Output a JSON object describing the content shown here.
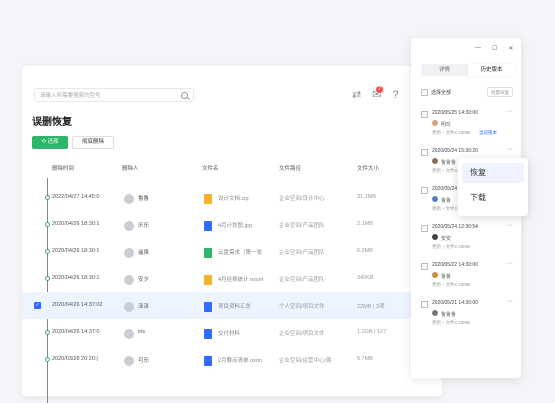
{
  "search": {
    "placeholder": "请输入所需要搜索的型号"
  },
  "page": {
    "title": "误删恢复"
  },
  "toolbar": {
    "restore_label": "还原",
    "delete_label": "彻底删除",
    "badge_count": "2"
  },
  "table": {
    "headers": [
      "删除时间",
      "删除人",
      "文件名",
      "文件路径",
      "文件大小"
    ],
    "rows": [
      {
        "time": "2022/04/27 14:45:0",
        "user": "鲁鲁",
        "file": "设计文档.zip",
        "path": "企业空间/设计中心",
        "size": "31.2MB",
        "icon": "zip-icon",
        "color": "#f5b22a"
      },
      {
        "time": "2020/04/26 18:30:1",
        "user": "乐乐",
        "file": "4月计划图.jpg",
        "path": "企业空间/产品团队",
        "size": "2.1MB",
        "icon": "image-icon",
        "color": "#2f6bff"
      },
      {
        "time": "2020/04/26 18:30:1",
        "user": "遥泉",
        "file": "云盘需求（第一张",
        "path": "企业空间/产品团队",
        "size": "6.2MB",
        "icon": "sheet-icon",
        "color": "#2db56a"
      },
      {
        "time": "2020/04/26 18:30:1",
        "user": "安夕",
        "file": "4月经费统计.excel",
        "path": "企业空间/产品团队",
        "size": "340KB",
        "icon": "excel-icon",
        "color": "#f5b22a"
      },
      {
        "time": "2020/04/26 14:37:02",
        "user": "泽泽",
        "file": "项目资料汇总",
        "path": "个人空间/项目文件",
        "size": "22MB | 3项",
        "icon": "folder-icon",
        "color": "#2f6bff"
      },
      {
        "time": "2020/04/26 14:37:0",
        "user": "iris",
        "file": "交付材料",
        "path": "企业空间/项目文件",
        "size": "1.2GB | 127",
        "icon": "folder-icon",
        "color": "#2f6bff"
      },
      {
        "time": "2020/03/28 20:20:(",
        "user": "可乐",
        "file": "2月要点清单.oxon",
        "path": "企业空间/运营中心/周",
        "size": "5.7MB",
        "icon": "doc-icon",
        "color": "#2f6bff"
      }
    ]
  },
  "panel": {
    "tabs": [
      "详情",
      "历史版本"
    ],
    "select_all": "选择全部",
    "batch": "批量恢复",
    "versions": [
      {
        "time": "2020/05/25 14:30:00",
        "name": "明珍",
        "info": "更新・文件2.33MB",
        "current": "当前版本"
      },
      {
        "time": "2020/05/24 15:30:20",
        "name": "鲁鲁鲁",
        "info": "更新・文件2.33MB",
        "current": ""
      },
      {
        "time": "2020/05/24 15:30:20",
        "name": "鲁鲁",
        "info": "更新・文件2.33MB",
        "current": ""
      },
      {
        "time": "2020/05/24 12:30:54",
        "name": "安安",
        "info": "更新・文件2.33MB",
        "current": ""
      },
      {
        "time": "2020/05/22 14:30:00",
        "name": "鲁鲁",
        "info": "更新・文件2.33MB",
        "current": ""
      },
      {
        "time": "2020/05/21 14:30:00",
        "name": "鲁鲁鲁",
        "info": "更新・文件2.33MB",
        "current": ""
      }
    ]
  },
  "context_menu": {
    "restore": "恢复",
    "download": "下载"
  }
}
